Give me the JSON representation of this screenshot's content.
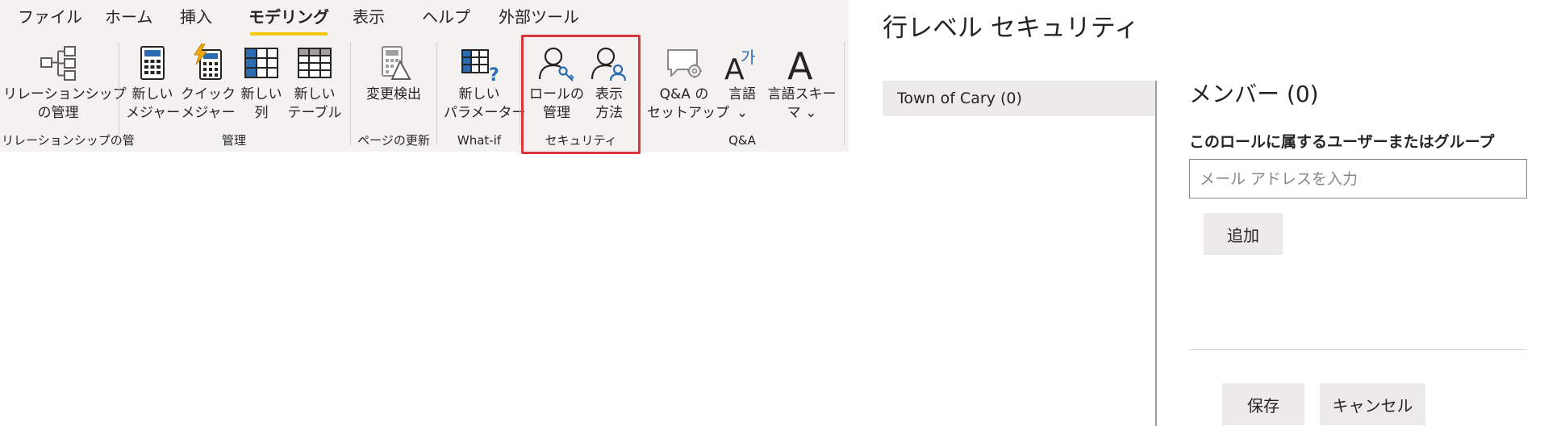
{
  "ribbon": {
    "tabs": [
      {
        "label": "ファイル",
        "active": false
      },
      {
        "label": "ホーム",
        "active": false
      },
      {
        "label": "挿入",
        "active": false
      },
      {
        "label": "モデリング",
        "active": true
      },
      {
        "label": "表示",
        "active": false
      },
      {
        "label": "ヘルプ",
        "active": false
      },
      {
        "label": "外部ツール",
        "active": false
      }
    ],
    "buttons": {
      "manage_relationships": [
        "リレーションシップ",
        "の管理"
      ],
      "new_measure": [
        "新しい",
        "メジャー"
      ],
      "quick_measure": [
        "クイック",
        "メジャー"
      ],
      "new_column": [
        "新しい",
        "列"
      ],
      "new_table": [
        "新しい",
        "テーブル"
      ],
      "change_detection": [
        "変更検出"
      ],
      "new_parameter": [
        "新しい",
        "パラメーター"
      ],
      "manage_roles": [
        "ロールの",
        "管理"
      ],
      "view_as": [
        "表示",
        "方法"
      ],
      "qa_setup": [
        "Q&A の",
        "セットアップ"
      ],
      "language": [
        "言語",
        "⌄"
      ],
      "linguistic_schema": [
        "言語スキー",
        "マ ⌄"
      ]
    },
    "groups": {
      "relationships": "リレーションシップの管",
      "calculations": "管理",
      "page_refresh": "ページの更新",
      "what_if": "What-if",
      "security": "セキュリティ",
      "qa": "Q&A"
    },
    "colors": {
      "accent": "#f2c811",
      "highlight_border": "#d9363e",
      "icon_blue": "#2b6cb0"
    }
  },
  "dialog": {
    "title": "行レベル セキュリティ",
    "roles": [
      {
        "label": "Town of Cary (0)"
      }
    ],
    "members_title": "メンバー (0)",
    "members_subtitle": "このロールに属するユーザーまたはグループ",
    "email_placeholder": "メール アドレスを入力",
    "email_value": "",
    "add_label": "追加",
    "save_label": "保存",
    "cancel_label": "キャンセル"
  }
}
